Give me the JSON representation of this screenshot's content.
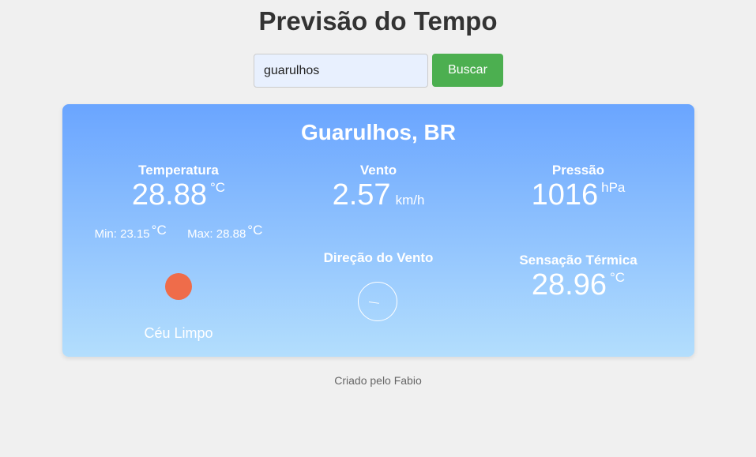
{
  "header": {
    "title": "Previsão do Tempo"
  },
  "search": {
    "value": "guarulhos",
    "button_label": "Buscar"
  },
  "weather": {
    "city": "Guarulhos, BR",
    "temperature": {
      "label": "Temperatura",
      "value": "28.88",
      "unit": "°C",
      "min_label": "Min: 23.15",
      "max_label": "Max: 28.88",
      "min_unit": "°C",
      "max_unit": "°C"
    },
    "wind": {
      "label": "Vento",
      "value": "2.57",
      "unit": "km/h"
    },
    "pressure": {
      "label": "Pressão",
      "value": "1016",
      "unit": "hPa"
    },
    "wind_direction": {
      "label": "Direção do Vento"
    },
    "feels_like": {
      "label": "Sensação Térmica",
      "value": "28.96",
      "unit": "°C"
    },
    "condition": "Céu Limpo",
    "icon": "sun-icon",
    "icon_color": "#ef6c4a"
  },
  "footer": {
    "text": "Criado pelo Fabio"
  },
  "colors": {
    "search_button": "#4caf50",
    "card_gradient_top": "#6aa5ff",
    "card_gradient_bottom": "#b3defd",
    "background": "#f0f0f0"
  }
}
